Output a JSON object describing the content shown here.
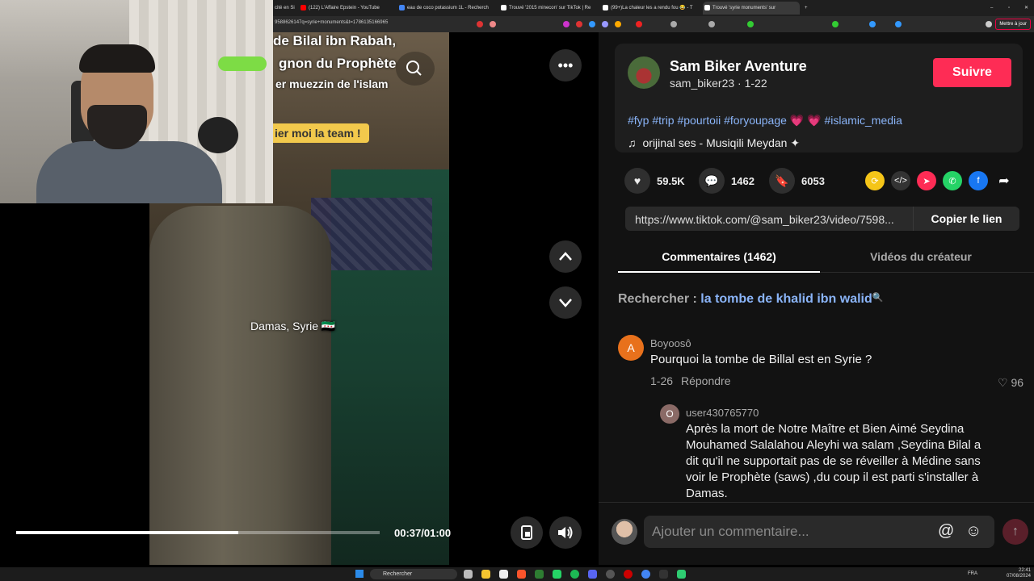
{
  "browser": {
    "tabs": [
      {
        "label": "cité en Si",
        "color": "#888"
      },
      {
        "label": "(122) L'Affaire Epstein - YouTube",
        "color": "#f00"
      },
      {
        "label": "eau de coco potassium 1L - Recherch",
        "color": "#4285f4"
      },
      {
        "label": "Trouvé '2015 minecon' sur TikTok | Re",
        "color": "#fff"
      },
      {
        "label": "(99+)La chaleur les a rendu fou 😂 - T",
        "color": "#fff"
      },
      {
        "label": "Trouvé 'syrie monuments' sur",
        "color": "#fff"
      }
    ],
    "url": "9588626147q=syrie+monuments&t=1786135166965",
    "bookmark_label": "Mettre à jour"
  },
  "video": {
    "overlay_title": "de Bilal ibn Rabah,",
    "overlay_line2": "gnon du Prophète",
    "overlay_line3": "er muezzin de l'islam",
    "overlay_tag": "ier moi la team !",
    "location": "Damas, Syrie 🇸🇾",
    "time": "00:37/01:00",
    "progress": 0.61
  },
  "creator": {
    "name": "Sam Biker Aventure",
    "handle": "sam_biker23 · 1-22",
    "follow_label": "Suivre",
    "hashtags": "#fyp #trip #pourtoii #foryoupage 💗 💗 #islamic_media",
    "music": "orijinal ses - Musiqili Meydan ✦"
  },
  "stats": {
    "likes": "59.5K",
    "comments": "1462",
    "saves": "6053"
  },
  "link": {
    "url": "https://www.tiktok.com/@sam_biker23/video/7598...",
    "copy_label": "Copier le lien"
  },
  "tabs": {
    "comments": "Commentaires (1462)",
    "videos": "Vidéos du créateur"
  },
  "search_suggest": {
    "prefix": "Rechercher :",
    "query": "la tombe de khalid ibn walid"
  },
  "comments": [
    {
      "initial": "A",
      "user": "Boyoosô",
      "text": "Pourquoi la tombe de Billal est en Syrie ?",
      "date": "1-26",
      "reply": "Répondre",
      "likes": "96"
    },
    {
      "initial": "O",
      "user": "user430765770",
      "text": "Après la mort de Notre Maître et Bien Aimé Seydina Mouhamed Salalahou Aleyhi wa salam ,Seydina Bilal a dit qu'il ne supportait pas de se réveiller à Médine sans voir le Prophète (saws) ,du coup il est parti s'installer à Damas."
    }
  ],
  "comment_input": {
    "placeholder": "Ajouter un commentaire..."
  },
  "taskbar": {
    "search": "Rechercher",
    "lang": "FRA",
    "time": "22:41",
    "date": "07/08/2024"
  },
  "colors": {
    "accent": "#fe2c55",
    "link": "#8ab4f8",
    "panel_bg": "#121212"
  }
}
